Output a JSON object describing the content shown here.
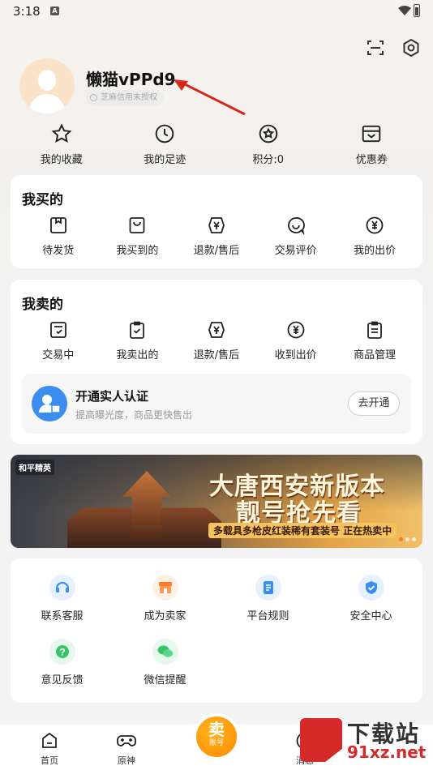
{
  "status": {
    "time": "3:18"
  },
  "profile": {
    "username": "懒猫vPPd9",
    "credit": "芝麻信用未授权"
  },
  "quick": [
    {
      "label": "我的收藏",
      "icon": "star-icon"
    },
    {
      "label": "我的足迹",
      "icon": "clock-icon"
    },
    {
      "label": "积分:0",
      "icon": "points-icon"
    },
    {
      "label": "优惠券",
      "icon": "coupon-icon"
    }
  ],
  "bought": {
    "title": "我买的",
    "items": [
      {
        "label": "待发货",
        "icon": "box-icon"
      },
      {
        "label": "我买到的",
        "icon": "bag-icon"
      },
      {
        "label": "退款/售后",
        "icon": "refund-icon"
      },
      {
        "label": "交易评价",
        "icon": "review-icon"
      },
      {
        "label": "我的出价",
        "icon": "bid-icon"
      }
    ]
  },
  "sold": {
    "title": "我卖的",
    "items": [
      {
        "label": "交易中",
        "icon": "trade-icon"
      },
      {
        "label": "我卖出的",
        "icon": "sold-clipboard-icon"
      },
      {
        "label": "退款/售后",
        "icon": "refund-icon"
      },
      {
        "label": "收到出价",
        "icon": "received-bid-icon"
      },
      {
        "label": "商品管理",
        "icon": "manage-icon"
      }
    ],
    "verify": {
      "title": "开通实人认证",
      "subtitle": "提高曝光度，商品更快售出",
      "button": "去开通"
    }
  },
  "banner": {
    "logo": "和平精英",
    "line1": "大唐西安新版本",
    "line2": "靓号抢先看",
    "line3": "多载具多枪皮红装稀有套装号 正在热卖中"
  },
  "services": [
    {
      "label": "联系客服",
      "icon": "headset-icon",
      "color": "#3b8ef0",
      "bg": "#e6f1ff"
    },
    {
      "label": "成为卖家",
      "icon": "shop-icon",
      "color": "#ff7a2a",
      "bg": "#fff0e4"
    },
    {
      "label": "平台规则",
      "icon": "document-icon",
      "color": "#3b8ef0",
      "bg": "#e6f1ff"
    },
    {
      "label": "安全中心",
      "icon": "shield-icon",
      "color": "#3b8ef0",
      "bg": "#e6f1ff"
    },
    {
      "label": "意见反馈",
      "icon": "question-icon",
      "color": "#38c36b",
      "bg": "#e6f8ec"
    },
    {
      "label": "微信提醒",
      "icon": "wechat-icon",
      "color": "#38c36b",
      "bg": "#e6f8ec"
    }
  ],
  "nav": {
    "home": "首页",
    "genshin": "原神",
    "sell_big": "卖",
    "sell_small": "账号",
    "messages": "消息"
  },
  "watermark": {
    "name": "下载站",
    "url": "91xz.net"
  }
}
